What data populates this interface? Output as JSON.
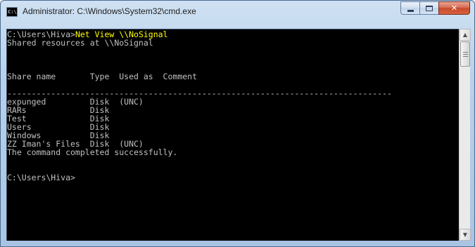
{
  "window": {
    "title": "Administrator: C:\\Windows\\System32\\cmd.exe",
    "icon_label": "C:\\",
    "icon": "cmd-console-icon",
    "minimize_icon": "minimize-icon",
    "maximize_icon": "maximize-icon",
    "close_icon": "close-icon",
    "close_glyph": "✕"
  },
  "console": {
    "text_color": "#c0c0c0",
    "command_color": "#ffff00",
    "background": "#000000",
    "lines": [
      {
        "prompt": "C:\\Users\\Hiva>",
        "command": "Net View \\\\NoSignal"
      },
      {
        "text": "Shared resources at \\\\NoSignal"
      },
      {
        "text": ""
      },
      {
        "text": ""
      },
      {
        "text": ""
      },
      {
        "text": "Share name       Type  Used as  Comment"
      },
      {
        "text": ""
      },
      {
        "text": "-------------------------------------------------------------------------------"
      },
      {
        "text": "expunged         Disk  (UNC)"
      },
      {
        "text": "RARs             Disk"
      },
      {
        "text": "Test             Disk"
      },
      {
        "text": "Users            Disk"
      },
      {
        "text": "Windows          Disk"
      },
      {
        "text": "ZZ Iman's Files  Disk  (UNC)"
      },
      {
        "text": "The command completed successfully."
      },
      {
        "text": ""
      },
      {
        "text": ""
      },
      {
        "text": "C:\\Users\\Hiva>"
      }
    ]
  },
  "scrollbar": {
    "up_arrow": "▲",
    "down_arrow": "▼",
    "up_icon": "scroll-up-arrow-icon",
    "down_icon": "scroll-down-arrow-icon"
  }
}
